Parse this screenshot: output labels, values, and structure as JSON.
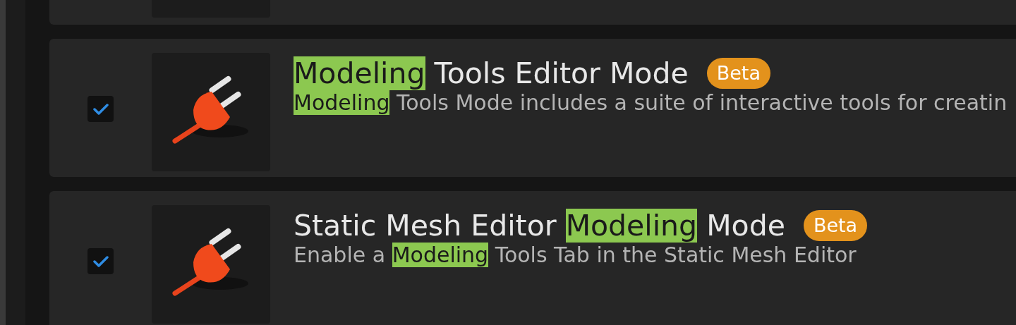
{
  "plugins": [
    {
      "title_parts": [
        {
          "text": "Modeling",
          "highlighted": true
        },
        {
          "text": " Tools Editor Mode",
          "highlighted": false
        }
      ],
      "badge": "Beta",
      "description_parts": [
        {
          "text": "Modeling",
          "highlighted": true
        },
        {
          "text": " Tools Mode includes a suite of interactive tools for creatin",
          "highlighted": false
        }
      ],
      "enabled": true
    },
    {
      "title_parts": [
        {
          "text": "Static Mesh Editor ",
          "highlighted": false
        },
        {
          "text": "Modeling",
          "highlighted": true
        },
        {
          "text": " Mode",
          "highlighted": false
        }
      ],
      "badge": "Beta",
      "description_parts": [
        {
          "text": "Enable a ",
          "highlighted": false
        },
        {
          "text": "Modeling",
          "highlighted": true
        },
        {
          "text": " Tools Tab in the Static Mesh Editor",
          "highlighted": false
        }
      ],
      "enabled": true
    }
  ]
}
